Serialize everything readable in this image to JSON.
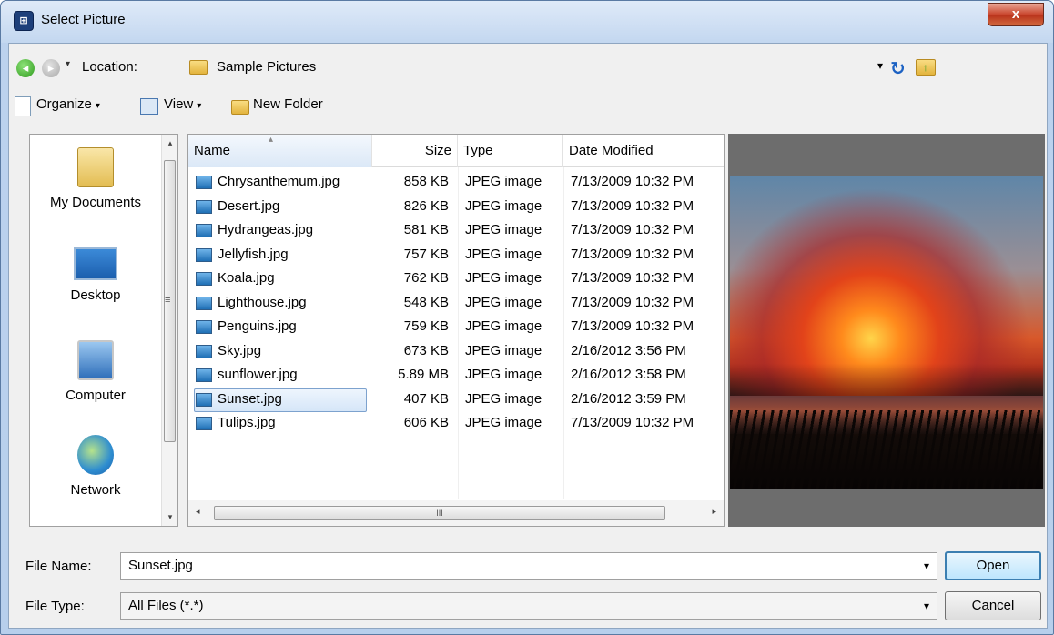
{
  "window": {
    "title": "Select Picture",
    "app_icon": "dialog-icon",
    "close_label": "x"
  },
  "location": {
    "label": "Location:",
    "value": "Sample Pictures",
    "back_icon": "back-arrow-icon",
    "forward_icon": "forward-arrow-icon",
    "dropdown_glyph": "▾"
  },
  "toolbar": {
    "organize": "Organize",
    "view": "View",
    "new_folder": "New Folder"
  },
  "places": [
    {
      "label": "My Documents",
      "icon": "my-documents-icon"
    },
    {
      "label": "Desktop",
      "icon": "desktop-icon"
    },
    {
      "label": "Computer",
      "icon": "computer-icon"
    },
    {
      "label": "Network",
      "icon": "network-icon"
    }
  ],
  "columns": {
    "name": "Name",
    "size": "Size",
    "type": "Type",
    "date": "Date Modified"
  },
  "files": [
    {
      "name": "Chrysanthemum.jpg",
      "size": "858 KB",
      "type": "JPEG image",
      "date": "7/13/2009 10:32 PM"
    },
    {
      "name": "Desert.jpg",
      "size": "826 KB",
      "type": "JPEG image",
      "date": "7/13/2009 10:32 PM"
    },
    {
      "name": "Hydrangeas.jpg",
      "size": "581 KB",
      "type": "JPEG image",
      "date": "7/13/2009 10:32 PM"
    },
    {
      "name": "Jellyfish.jpg",
      "size": "757 KB",
      "type": "JPEG image",
      "date": "7/13/2009 10:32 PM"
    },
    {
      "name": "Koala.jpg",
      "size": "762 KB",
      "type": "JPEG image",
      "date": "7/13/2009 10:32 PM"
    },
    {
      "name": "Lighthouse.jpg",
      "size": "548 KB",
      "type": "JPEG image",
      "date": "7/13/2009 10:32 PM"
    },
    {
      "name": "Penguins.jpg",
      "size": "759 KB",
      "type": "JPEG image",
      "date": "7/13/2009 10:32 PM"
    },
    {
      "name": "Sky.jpg",
      "size": "673 KB",
      "type": "JPEG image",
      "date": "2/16/2012 3:56 PM"
    },
    {
      "name": "sunflower.jpg",
      "size": "5.89 MB",
      "type": "JPEG image",
      "date": "2/16/2012 3:58 PM"
    },
    {
      "name": "Sunset.jpg",
      "size": "407 KB",
      "type": "JPEG image",
      "date": "2/16/2012 3:59 PM"
    },
    {
      "name": "Tulips.jpg",
      "size": "606 KB",
      "type": "JPEG image",
      "date": "7/13/2009 10:32 PM"
    }
  ],
  "selected_file": "Sunset.jpg",
  "file_name": {
    "label": "File Name:",
    "value": "Sunset.jpg"
  },
  "file_type": {
    "label": "File Type:",
    "value": "All Files (*.*)"
  },
  "buttons": {
    "open": "Open",
    "cancel": "Cancel"
  },
  "scroll": {
    "grip": "≡",
    "hgrip": "III",
    "left": "◂",
    "right": "▸",
    "up": "▴",
    "down": "▾"
  },
  "colors": {
    "selection_border": "#7da2ce",
    "close_button": "#c9452d",
    "title_bar": "#c3d7f0"
  }
}
